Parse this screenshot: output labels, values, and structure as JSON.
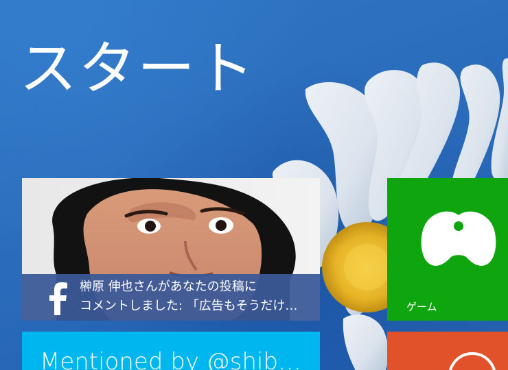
{
  "start_screen": {
    "title": "スタート"
  },
  "tiles": {
    "facebook": {
      "line1": "榊原 伸也さんがあなたの投稿に",
      "line2": "コメントしました: 「広告もそうだけ…"
    },
    "game": {
      "label": "ゲーム"
    },
    "twitter": {
      "text": "Mentioned by @shib…"
    }
  },
  "colors": {
    "background": "#2a6ebc",
    "facebook_blue": "#3b5998",
    "game_green": "#0ea50e",
    "twitter_cyan": "#00b6ef",
    "orange_tile": "#e1522b"
  }
}
